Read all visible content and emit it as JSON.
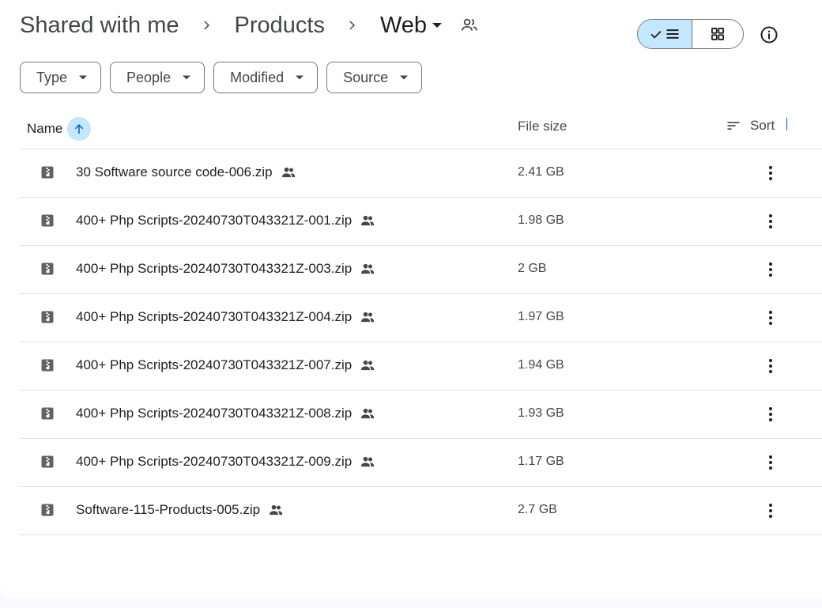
{
  "breadcrumb": {
    "items": [
      "Shared with me",
      "Products"
    ],
    "current": "Web"
  },
  "filters": [
    "Type",
    "People",
    "Modified",
    "Source"
  ],
  "table": {
    "columns": {
      "name": "Name",
      "size": "File size",
      "sort": "Sort"
    },
    "rows": [
      {
        "name": "30 Software source code-006.zip",
        "size": "2.41 GB"
      },
      {
        "name": "400+ Php Scripts-20240730T043321Z-001.zip",
        "size": "1.98 GB"
      },
      {
        "name": "400+ Php Scripts-20240730T043321Z-003.zip",
        "size": "2 GB"
      },
      {
        "name": "400+ Php Scripts-20240730T043321Z-004.zip",
        "size": "1.97 GB"
      },
      {
        "name": "400+ Php Scripts-20240730T043321Z-007.zip",
        "size": "1.94 GB"
      },
      {
        "name": "400+ Php Scripts-20240730T043321Z-008.zip",
        "size": "1.93 GB"
      },
      {
        "name": "400+ Php Scripts-20240730T043321Z-009.zip",
        "size": "1.17 GB"
      },
      {
        "name": "Software-115-Products-005.zip",
        "size": "2.7 GB"
      }
    ]
  },
  "colors": {
    "accent": "#c2e7ff",
    "accent_dark": "#0b57d0",
    "text": "#1f1f1f",
    "secondary_text": "#444746",
    "divider": "#e0e0e0"
  },
  "icons": {
    "file": "zip-file-icon",
    "shared": "people-icon",
    "more": "more-vert-icon",
    "sort": "sort-icon",
    "view_list": "list-view-icon",
    "view_grid": "grid-view-icon",
    "info": "info-icon"
  }
}
